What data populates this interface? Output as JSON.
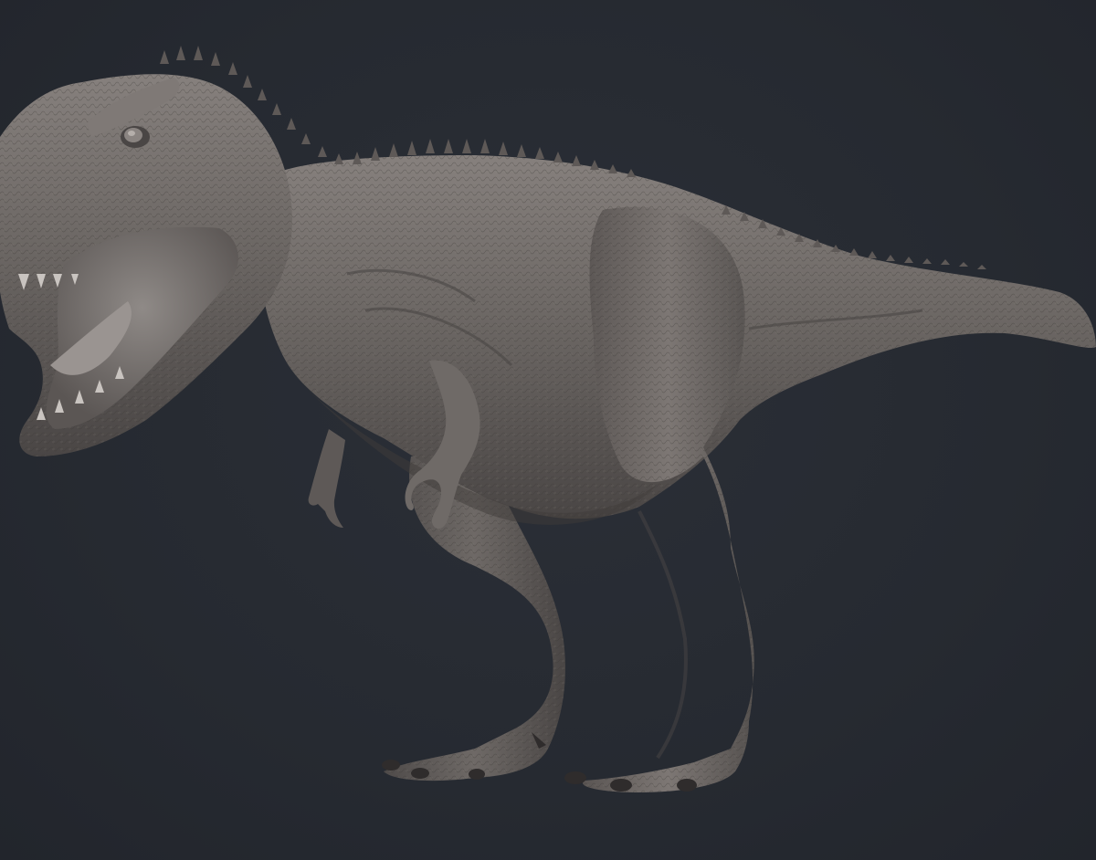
{
  "scene": {
    "subject": "trex-sculpt",
    "colors": {
      "background": "#262a31",
      "clay_base": "#6a6562",
      "clay_light": "#8c8683",
      "clay_dark": "#3f3b3a",
      "mouth_interior": "#7a7573",
      "claw": "#2f2c2c"
    }
  }
}
